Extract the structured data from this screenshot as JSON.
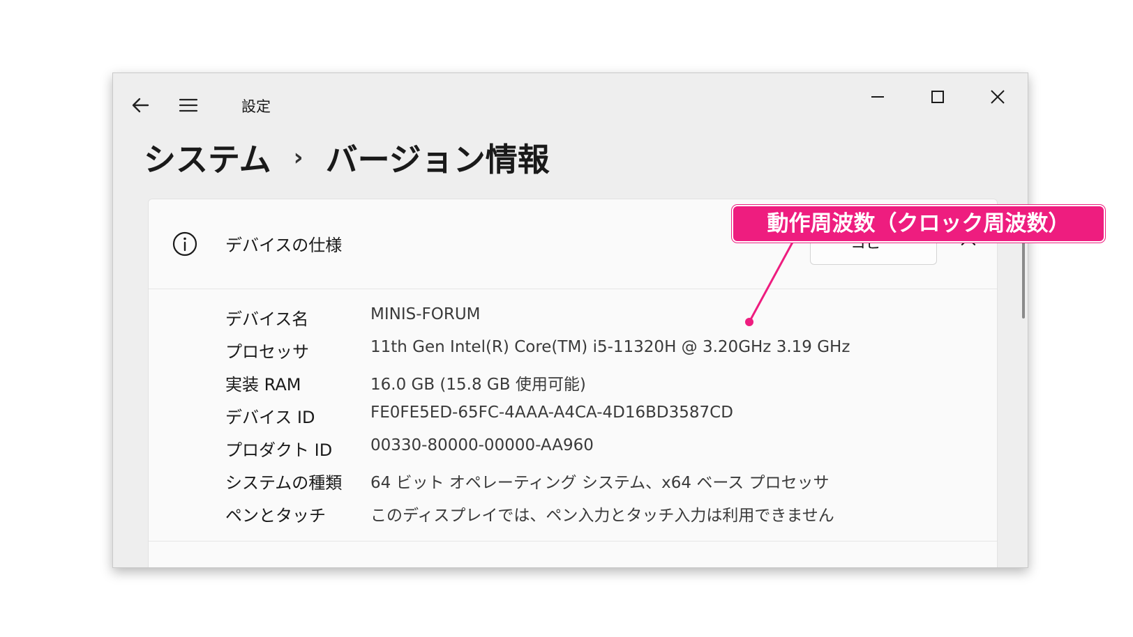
{
  "window": {
    "title": "設定",
    "icons": {
      "back": "back-arrow-icon",
      "menu": "hamburger-menu-icon",
      "minimize": "minimize-icon",
      "maximize": "maximize-icon",
      "close": "close-icon"
    }
  },
  "breadcrumb": {
    "parent": "システム",
    "separator": "›",
    "current": "バージョン情報"
  },
  "device_specs": {
    "title": "デバイスの仕様",
    "copy_label": "コピー",
    "icons": {
      "info": "info-circle-icon",
      "collapse": "chevron-up-icon"
    },
    "rows": [
      {
        "label": "デバイス名",
        "value": "MINIS-FORUM"
      },
      {
        "label": "プロセッサ",
        "value": "11th Gen Intel(R) Core(TM) i5-11320H @ 3.20GHz   3.19 GHz"
      },
      {
        "label": "実装 RAM",
        "value": "16.0 GB (15.8 GB 使用可能)"
      },
      {
        "label": "デバイス ID",
        "value": "FE0FE5ED-65FC-4AAA-A4CA-4D16BD3587CD"
      },
      {
        "label": "プロダクト ID",
        "value": "00330-80000-00000-AA960"
      },
      {
        "label": "システムの種類",
        "value": "64 ビット オペレーティング システム、x64 ベース プロセッサ"
      },
      {
        "label": "ペンとタッチ",
        "value": "このディスプレイでは、ペン入力とタッチ入力は利用できません"
      }
    ]
  },
  "annotation": {
    "text": "動作周波数（クロック周波数）",
    "color": "#ee1d7f"
  }
}
